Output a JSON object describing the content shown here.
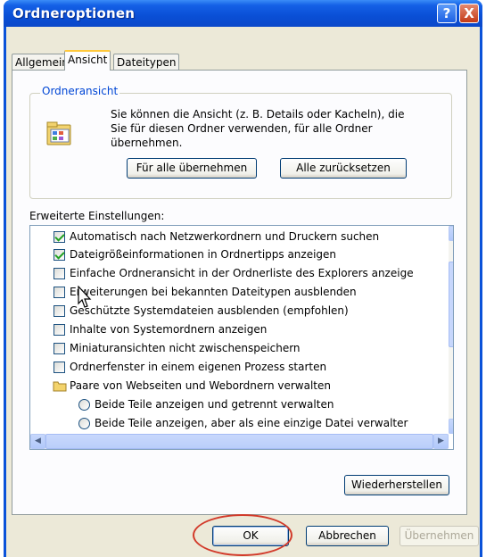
{
  "window": {
    "title": "Ordneroptionen",
    "help_label": "?",
    "close_label": "X"
  },
  "tabs": [
    {
      "label": "Allgemein",
      "active": false
    },
    {
      "label": "Ansicht",
      "active": true
    },
    {
      "label": "Dateitypen",
      "active": false
    }
  ],
  "folder_view": {
    "group_label": "Ordneransicht",
    "description": "Sie können die Ansicht (z. B. Details oder Kacheln), die Sie für diesen Ordner verwenden, für alle Ordner übernehmen.",
    "apply_all_label": "Für alle übernehmen",
    "reset_all_label": "Alle zurücksetzen"
  },
  "advanced": {
    "label": "Erweiterte Einstellungen:",
    "items": [
      {
        "type": "checkbox",
        "checked": true,
        "label": "Automatisch nach Netzwerkordnern und Druckern suchen"
      },
      {
        "type": "checkbox",
        "checked": true,
        "label": "Dateigrößeinformationen in Ordnertipps anzeigen"
      },
      {
        "type": "checkbox",
        "checked": false,
        "label": "Einfache Ordneransicht in der Ordnerliste des Explorers anzeige"
      },
      {
        "type": "checkbox",
        "checked": false,
        "label": "Erweiterungen bei bekannten Dateitypen ausblenden"
      },
      {
        "type": "checkbox",
        "checked": false,
        "label": "Geschützte Systemdateien ausblenden (empfohlen)"
      },
      {
        "type": "checkbox",
        "checked": false,
        "label": "Inhalte von Systemordnern anzeigen"
      },
      {
        "type": "checkbox",
        "checked": false,
        "label": "Miniaturansichten nicht zwischenspeichern"
      },
      {
        "type": "checkbox",
        "checked": false,
        "label": "Ordnerfenster in einem eigenen Prozess starten"
      },
      {
        "type": "folder",
        "label": "Paare von Webseiten und Webordnern verwalten"
      },
      {
        "type": "radio",
        "checked": false,
        "label": "Beide Teile anzeigen und getrennt verwalten"
      },
      {
        "type": "radio",
        "checked": false,
        "label": "Beide Teile anzeigen, aber als eine einzige Datei verwalter"
      }
    ],
    "restore_label": "Wiederherstellen"
  },
  "footer": {
    "ok_label": "OK",
    "cancel_label": "Abbrechen",
    "apply_label": "Übernehmen"
  },
  "colors": {
    "titlebar": "#0a4fd6",
    "dialog_bg": "#ece9d8",
    "annotation_circle": "#d23a2a"
  }
}
